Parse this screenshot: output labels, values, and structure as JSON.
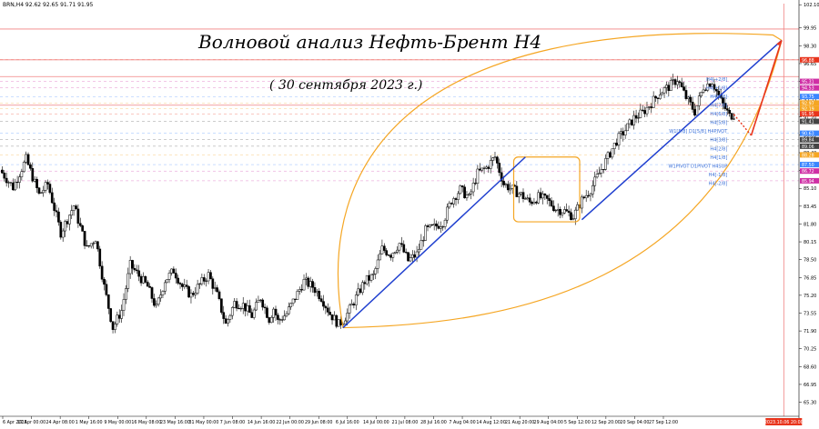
{
  "header": {
    "symbol_line": "BRN,H4  92.62 92.65 91.71 91.95"
  },
  "annotations": {
    "title": "Волновой анализ Нефть-Брент H4",
    "date": "( 30 сентября 2023 г.)"
  },
  "colors": {
    "candle": "#000000",
    "wave_line": "#1f3fcf",
    "arc": "#f5a623",
    "forecast": "#e8341c",
    "grid_red": "#f08080",
    "grid_pink": "#e88ccf",
    "grid_blue": "#7fb0ff",
    "now_line": "#f08080"
  },
  "chart_data": {
    "type": "candlestick",
    "ylim": [
      64.0,
      102.2
    ],
    "y_ticks": [
      "102.10",
      "99.95",
      "98.30",
      "96.65",
      "95.00",
      "93.35",
      "91.70",
      "90.05",
      "88.40",
      "86.75",
      "85.10",
      "83.45",
      "81.80",
      "80.15",
      "78.50",
      "76.85",
      "75.20",
      "73.55",
      "71.90",
      "70.25",
      "68.60",
      "66.95",
      "65.30"
    ],
    "x_ticks": [
      "6 Apr 2023",
      "17 Apr 00:00",
      "24 Apr 08:00",
      "1 May 16:00",
      "9 May 00:00",
      "16 May 08:00",
      "23 May 16:00",
      "31 May 00:00",
      "7 Jun 08:00",
      "14 Jun 16:00",
      "22 Jun 00:00",
      "29 Jun 08:00",
      "6 Jul 16:00",
      "14 Jul 00:00",
      "21 Jul 08:00",
      "28 Jul 16:00",
      "7 Aug 04:00",
      "14 Aug 12:00",
      "21 Aug 20:00",
      "29 Aug 04:00",
      "5 Sep 12:00",
      "12 Sep 20:00",
      "20 Sep 04:00",
      "27 Sep 12:00"
    ],
    "current_time_label": "2023.10.06 20:00",
    "price_path": [
      [
        0,
        86.8
      ],
      [
        3,
        85.2
      ],
      [
        6,
        87.8
      ],
      [
        9,
        84.5
      ],
      [
        11,
        85.5
      ],
      [
        14,
        81.0
      ],
      [
        17,
        83.5
      ],
      [
        20,
        79.5
      ],
      [
        22,
        80.5
      ],
      [
        24,
        76.0
      ],
      [
        26,
        72.2
      ],
      [
        28,
        73.8
      ],
      [
        30,
        78.0
      ],
      [
        32,
        77.0
      ],
      [
        34,
        76.0
      ],
      [
        36,
        74.0
      ],
      [
        38,
        76.6
      ],
      [
        40,
        77.5
      ],
      [
        42,
        76.0
      ],
      [
        44,
        75.2
      ],
      [
        46,
        76.2
      ],
      [
        48,
        77.1
      ],
      [
        50,
        75.2
      ],
      [
        52,
        72.5
      ],
      [
        54,
        74.5
      ],
      [
        56,
        74.3
      ],
      [
        58,
        73.3
      ],
      [
        60,
        75.0
      ],
      [
        62,
        73.0
      ],
      [
        63,
        74.0
      ],
      [
        64,
        72.8
      ],
      [
        66,
        73.5
      ],
      [
        68,
        75.0
      ],
      [
        70,
        76.5
      ],
      [
        72,
        76.0
      ],
      [
        74,
        75.0
      ],
      [
        76,
        73.5
      ],
      [
        78,
        72.5
      ],
      [
        79,
        72.9
      ],
      [
        80,
        73.5
      ],
      [
        82,
        75.0
      ],
      [
        84,
        76.5
      ],
      [
        86,
        77.0
      ],
      [
        88,
        79.5
      ],
      [
        90,
        79.0
      ],
      [
        92,
        80.0
      ],
      [
        94,
        78.4
      ],
      [
        96,
        79.0
      ],
      [
        98,
        81.2
      ],
      [
        100,
        81.5
      ],
      [
        102,
        82.0
      ],
      [
        104,
        84.0
      ],
      [
        106,
        85.0
      ],
      [
        108,
        84.2
      ],
      [
        110,
        86.5
      ],
      [
        112,
        87.0
      ],
      [
        114,
        88.0
      ],
      [
        116,
        85.5
      ],
      [
        118,
        85.0
      ],
      [
        120,
        84.5
      ],
      [
        122,
        83.8
      ],
      [
        124,
        84.3
      ],
      [
        126,
        84.0
      ],
      [
        128,
        83.2
      ],
      [
        130,
        83.0
      ],
      [
        132,
        82.5
      ],
      [
        134,
        84.0
      ],
      [
        136,
        85.0
      ],
      [
        138,
        86.5
      ],
      [
        140,
        88.0
      ],
      [
        142,
        89.5
      ],
      [
        144,
        90.5
      ],
      [
        146,
        91.6
      ],
      [
        148,
        92.1
      ],
      [
        150,
        93.0
      ],
      [
        152,
        94.0
      ],
      [
        154,
        94.5
      ],
      [
        156,
        95.2
      ],
      [
        158,
        93.5
      ],
      [
        160,
        92.2
      ],
      [
        162,
        94.5
      ],
      [
        164,
        95.0
      ],
      [
        166,
        93.2
      ],
      [
        168,
        91.8
      ],
      [
        169,
        91.95
      ]
    ],
    "forecast_path": [
      [
        169,
        91.95
      ],
      [
        172,
        90.5
      ],
      [
        176,
        95.5
      ],
      [
        180,
        98.8
      ]
    ],
    "wave_lines": [
      [
        [
          0,
          72.2
        ],
        [
          78,
          88.0
        ]
      ],
      [
        [
          86,
          82.2
        ],
        [
          180,
          98.8
        ]
      ]
    ],
    "channel_box": {
      "x": [
        78,
        86
      ],
      "y": [
        82.0,
        88.0
      ]
    },
    "arc": {
      "start": [
        0,
        72.2
      ],
      "end": [
        180,
        98.8
      ]
    },
    "red_levels": [
      {
        "y": 99.85,
        "label": "100.05"
      },
      {
        "y": 97.0,
        "label": "96.88"
      },
      {
        "y": 95.45,
        "label": ""
      },
      {
        "y": 92.8,
        "label": ""
      }
    ],
    "price_labels": [
      {
        "y": 97.0,
        "text": "96.88",
        "color": "#e8341c"
      },
      {
        "y": 95.0,
        "text": "95.31",
        "color": "#cf2fa5"
      },
      {
        "y": 94.4,
        "text": "94.53",
        "color": "#cf2fa5"
      },
      {
        "y": 93.6,
        "text": "93.75",
        "color": "#3a86ff"
      },
      {
        "y": 93.0,
        "text": "92.97",
        "color": "#f5a623"
      },
      {
        "y": 92.5,
        "text": "92.19",
        "color": "#f5a623"
      },
      {
        "y": 92.0,
        "text": "91.95",
        "color": "#e8341c"
      },
      {
        "y": 91.3,
        "text": "91.41",
        "color": "#444444"
      },
      {
        "y": 90.2,
        "text": "90.63",
        "color": "#3a86ff"
      },
      {
        "y": 89.6,
        "text": "89.84",
        "color": "#444444"
      },
      {
        "y": 89.0,
        "text": "89.06",
        "color": "#444444"
      },
      {
        "y": 88.2,
        "text": "88.28",
        "color": "#f5a623"
      },
      {
        "y": 87.3,
        "text": "87.50",
        "color": "#3a86ff"
      },
      {
        "y": 86.7,
        "text": "86.72",
        "color": "#cf2fa5"
      },
      {
        "y": 85.8,
        "text": "85.94",
        "color": "#cf2fa5"
      }
    ],
    "murrey_labels": [
      {
        "y": 95.2,
        "text": "H4[+2/8]"
      },
      {
        "y": 94.4,
        "text": "H4[+1/8]"
      },
      {
        "y": 93.6,
        "text": "H4[8/8]"
      },
      {
        "y": 92.8,
        "text": "H4[7/8]"
      },
      {
        "y": 92.0,
        "text": "H4[6/8]"
      },
      {
        "y": 91.2,
        "text": "H4[5/8]"
      },
      {
        "y": 90.4,
        "text": "W1[5/8]  D1[5/8]  H4PIVOT"
      },
      {
        "y": 89.6,
        "text": "H4[3/8]"
      },
      {
        "y": 88.8,
        "text": "H4[2/8]"
      },
      {
        "y": 88.0,
        "text": "H4[1/8]"
      },
      {
        "y": 87.2,
        "text": "W1PIVOT  D1PIVOT  H4SUP"
      },
      {
        "y": 86.4,
        "text": "H4[-1/8]"
      },
      {
        "y": 85.6,
        "text": "H4[-2/8]"
      }
    ]
  }
}
